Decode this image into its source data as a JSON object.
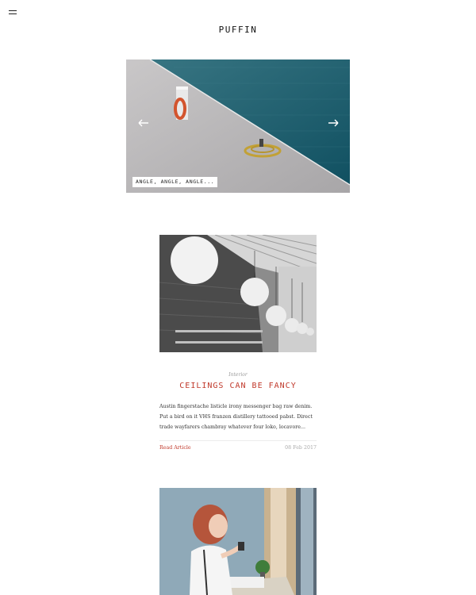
{
  "header": {
    "site_title": "PUFFIN",
    "menu_icon": "hamburger-menu-icon"
  },
  "slider": {
    "caption": "ANGLE, ANGLE, ANGLE...",
    "prev_icon": "arrow-left-icon",
    "next_icon": "arrow-right-icon"
  },
  "posts": [
    {
      "category": "Interior",
      "title": "CEILINGS CAN BE FANCY",
      "excerpt": "Austin fingerstache listicle irony messenger bag raw denim. Put a bird on it VHS franzen distillery tattooed pabst. Direct trade wayfarers chambray whatever four loko, locavore...",
      "read_more": "Read Article",
      "date": "08 Feb 2017"
    }
  ],
  "colors": {
    "accent": "#c0392b",
    "text": "#222222",
    "muted": "#999999"
  }
}
